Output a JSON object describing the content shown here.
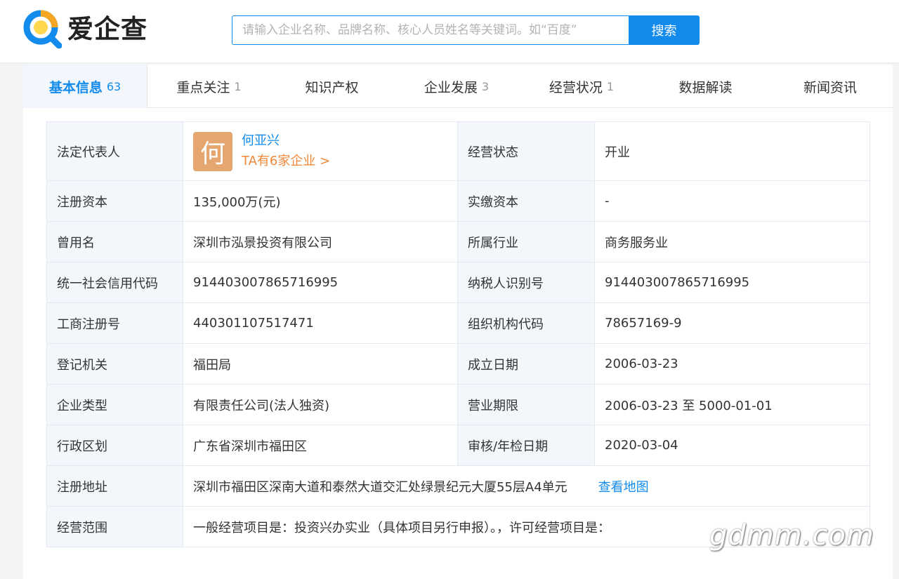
{
  "header": {
    "logo_text": "爱企查",
    "search_placeholder": "请输入企业名称、品牌名称、核心人员姓名等关键词。如“百度”",
    "search_button": "搜索"
  },
  "tabs": [
    {
      "label": "基本信息",
      "count": "63"
    },
    {
      "label": "重点关注",
      "count": "1"
    },
    {
      "label": "知识产权",
      "count": ""
    },
    {
      "label": "企业发展",
      "count": "3"
    },
    {
      "label": "经营状况",
      "count": "1"
    },
    {
      "label": "数据解读",
      "count": ""
    },
    {
      "label": "新闻资讯",
      "count": ""
    }
  ],
  "info": {
    "legal_rep_label": "法定代表人",
    "legal_rep_avatar": "何",
    "legal_rep_name": "何亚兴",
    "legal_rep_link": "TA有6家企业 >",
    "status_label": "经营状态",
    "status_value": "开业",
    "rows": [
      {
        "l1": "注册资本",
        "v1": "135,000万(元)",
        "l2": "实缴资本",
        "v2": "-"
      },
      {
        "l1": "曾用名",
        "v1": "深圳市泓景投资有限公司",
        "l2": "所属行业",
        "v2": "商务服务业"
      },
      {
        "l1": "统一社会信用代码",
        "v1": "914403007865716995",
        "l2": "纳税人识别号",
        "v2": "914403007865716995"
      },
      {
        "l1": "工商注册号",
        "v1": "440301107517471",
        "l2": "组织机构代码",
        "v2": "78657169-9"
      },
      {
        "l1": "登记机关",
        "v1": "福田局",
        "l2": "成立日期",
        "v2": "2006-03-23"
      },
      {
        "l1": "企业类型",
        "v1": "有限责任公司(法人独资)",
        "l2": "营业期限",
        "v2": "2006-03-23 至 5000-01-01"
      },
      {
        "l1": "行政区划",
        "v1": "广东省深圳市福田区",
        "l2": "审核/年检日期",
        "v2": "2020-03-04"
      }
    ],
    "address_label": "注册地址",
    "address_value": "深圳市福田区深南大道和泰然大道交汇处绿景纪元大厦55层A4单元",
    "map_link": "查看地图",
    "scope_label": "经营范围",
    "scope_value": "一般经营项目是：投资兴办实业（具体项目另行申报）。，许可经营项目是："
  },
  "watermark": "gdmm.com",
  "colors": {
    "accent": "#128bed",
    "link_orange": "#f0883a",
    "avatar_bg": "#e6a66f",
    "label_bg": "#f3f7fc"
  }
}
